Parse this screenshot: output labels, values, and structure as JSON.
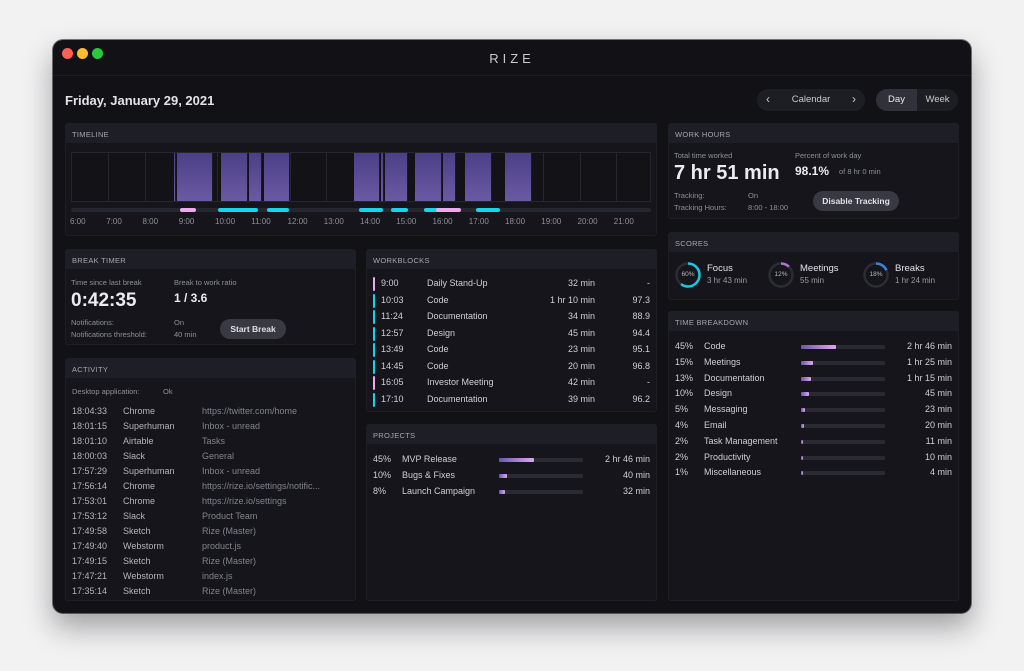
{
  "window": {
    "title": "RIZE"
  },
  "header": {
    "date": "Friday, January 29, 2021",
    "calendar": {
      "label": "Calendar",
      "prev_icon": "chevron-left-icon",
      "next_icon": "chevron-right-icon"
    },
    "view_toggle": {
      "options": [
        "Day",
        "Week"
      ],
      "selected": "Day"
    }
  },
  "timeline": {
    "title": "TIMELINE",
    "hour_labels": [
      "6:00",
      "7:00",
      "8:00",
      "9:00",
      "10:00",
      "11:00",
      "12:00",
      "13:00",
      "14:00",
      "15:00",
      "16:00",
      "17:00",
      "18:00",
      "19:00",
      "20:00",
      "21:00"
    ],
    "range_hours": [
      6,
      22
    ],
    "activity_blocks": [
      {
        "start": 8.8,
        "end": 8.87
      },
      {
        "start": 8.9,
        "end": 9.9
      },
      {
        "start": 10.1,
        "end": 10.85
      },
      {
        "start": 10.87,
        "end": 11.25
      },
      {
        "start": 11.3,
        "end": 12.02
      },
      {
        "start": 13.77,
        "end": 14.5
      },
      {
        "start": 14.52,
        "end": 14.6
      },
      {
        "start": 14.63,
        "end": 15.28
      },
      {
        "start": 15.45,
        "end": 16.2
      },
      {
        "start": 16.23,
        "end": 16.58
      },
      {
        "start": 16.83,
        "end": 17.58
      },
      {
        "start": 17.95,
        "end": 18.68
      }
    ],
    "workblock_marks": [
      {
        "start": 9.0,
        "end": 9.45,
        "type": "meeting"
      },
      {
        "start": 10.05,
        "end": 11.17,
        "type": "focus"
      },
      {
        "start": 11.4,
        "end": 12.0,
        "type": "focus"
      },
      {
        "start": 13.95,
        "end": 14.6,
        "type": "focus"
      },
      {
        "start": 14.82,
        "end": 15.3,
        "type": "focus"
      },
      {
        "start": 15.75,
        "end": 16.2,
        "type": "focus"
      },
      {
        "start": 16.08,
        "end": 16.75,
        "type": "meeting",
        "adjust": true
      },
      {
        "start": 17.17,
        "end": 17.83,
        "type": "focus"
      }
    ],
    "colors": {
      "focus": "#12d6ea",
      "meeting": "#f0a8ee",
      "block": "#5a4b98"
    }
  },
  "work_hours": {
    "title": "WORK HOURS",
    "total_label": "Total time worked",
    "total_value": "7 hr 51 min",
    "percent_label": "Percent of work day",
    "percent_value": "98.1%",
    "percent_of": "of 8 hr 0 min",
    "tracking_label": "Tracking:",
    "tracking_value": "On",
    "hours_label": "Tracking Hours:",
    "hours_value": "8:00 - 18:00",
    "button": "Disable Tracking"
  },
  "scores": {
    "title": "SCORES",
    "items": [
      {
        "name": "Focus",
        "percent": 60,
        "percent_label": "60%",
        "time": "3 hr 43 min",
        "color": "#18c8dc"
      },
      {
        "name": "Meetings",
        "percent": 12,
        "percent_label": "12%",
        "time": "55 min",
        "color": "#b571d8"
      },
      {
        "name": "Breaks",
        "percent": 18,
        "percent_label": "18%",
        "time": "1 hr 24 min",
        "color": "#3c82dc"
      }
    ]
  },
  "time_breakdown": {
    "title": "TIME BREAKDOWN",
    "items": [
      {
        "pct": "45%",
        "value": 45,
        "name": "Code",
        "time": "2 hr 46 min"
      },
      {
        "pct": "15%",
        "value": 15,
        "name": "Meetings",
        "time": "1 hr 25 min"
      },
      {
        "pct": "13%",
        "value": 13,
        "name": "Documentation",
        "time": "1 hr 15 min"
      },
      {
        "pct": "10%",
        "value": 10,
        "name": "Design",
        "time": "45 min"
      },
      {
        "pct": "5%",
        "value": 5,
        "name": "Messaging",
        "time": "23 min"
      },
      {
        "pct": "4%",
        "value": 4,
        "name": "Email",
        "time": "20 min"
      },
      {
        "pct": "2%",
        "value": 2,
        "name": "Task Management",
        "time": "11 min"
      },
      {
        "pct": "2%",
        "value": 2,
        "name": "Productivity",
        "time": "10 min"
      },
      {
        "pct": "1%",
        "value": 1,
        "name": "Miscellaneous",
        "time": "4 min"
      }
    ]
  },
  "break_timer": {
    "title": "BREAK TIMER",
    "since_label": "Time since last break",
    "since_value": "0:42:35",
    "ratio_label": "Break to work ratio",
    "ratio_value": "1 / 3.6",
    "notifications_label": "Notifications:",
    "notifications_value": "On",
    "threshold_label": "Notifications threshold:",
    "threshold_value": "40 min",
    "button": "Start Break"
  },
  "activity": {
    "title": "ACTIVITY",
    "status_label": "Desktop application:",
    "status_value": "Ok",
    "rows": [
      {
        "time": "18:04:33",
        "app": "Chrome",
        "detail": "https://twitter.com/home"
      },
      {
        "time": "18:01:15",
        "app": "Superhuman",
        "detail": "Inbox - unread"
      },
      {
        "time": "18:01:10",
        "app": "Airtable",
        "detail": "Tasks"
      },
      {
        "time": "18:00:03",
        "app": "Slack",
        "detail": "General"
      },
      {
        "time": "17:57:29",
        "app": "Superhuman",
        "detail": "Inbox - unread"
      },
      {
        "time": "17:56:14",
        "app": "Chrome",
        "detail": "https://rize.io/settings/notific..."
      },
      {
        "time": "17:53:01",
        "app": "Chrome",
        "detail": "https://rize.io/settings"
      },
      {
        "time": "17:53:12",
        "app": "Slack",
        "detail": "Product Team"
      },
      {
        "time": "17:49:58",
        "app": "Sketch",
        "detail": "Rize (Master)"
      },
      {
        "time": "17:49:40",
        "app": "Webstorm",
        "detail": "product.js"
      },
      {
        "time": "17:49:15",
        "app": "Sketch",
        "detail": "Rize (Master)"
      },
      {
        "time": "17:47:21",
        "app": "Webstorm",
        "detail": "index.js"
      },
      {
        "time": "17:35:14",
        "app": "Sketch",
        "detail": "Rize (Master)"
      }
    ]
  },
  "workblocks": {
    "title": "WORKBLOCKS",
    "rows": [
      {
        "time": "9:00",
        "name": "Daily Stand-Up",
        "duration": "32 min",
        "score": "-",
        "type": "meeting"
      },
      {
        "time": "10:03",
        "name": "Code",
        "duration": "1 hr 10 min",
        "score": "97.3",
        "type": "focus"
      },
      {
        "time": "11:24",
        "name": "Documentation",
        "duration": "34 min",
        "score": "88.9",
        "type": "focus"
      },
      {
        "time": "12:57",
        "name": "Design",
        "duration": "45 min",
        "score": "94.4",
        "type": "focus"
      },
      {
        "time": "13:49",
        "name": "Code",
        "duration": "23 min",
        "score": "95.1",
        "type": "focus"
      },
      {
        "time": "14:45",
        "name": "Code",
        "duration": "20 min",
        "score": "96.8",
        "type": "focus"
      },
      {
        "time": "16:05",
        "name": "Investor Meeting",
        "duration": "42 min",
        "score": "-",
        "type": "meeting"
      },
      {
        "time": "17:10",
        "name": "Documentation",
        "duration": "39 min",
        "score": "96.2",
        "type": "focus"
      }
    ]
  },
  "projects": {
    "title": "PROJECTS",
    "items": [
      {
        "pct": "45%",
        "value": 45,
        "name": "MVP Release",
        "time": "2 hr 46 min"
      },
      {
        "pct": "10%",
        "value": 10,
        "name": "Bugs & Fixes",
        "time": "40 min"
      },
      {
        "pct": "8%",
        "value": 8,
        "name": "Launch Campaign",
        "time": "32 min"
      }
    ]
  }
}
